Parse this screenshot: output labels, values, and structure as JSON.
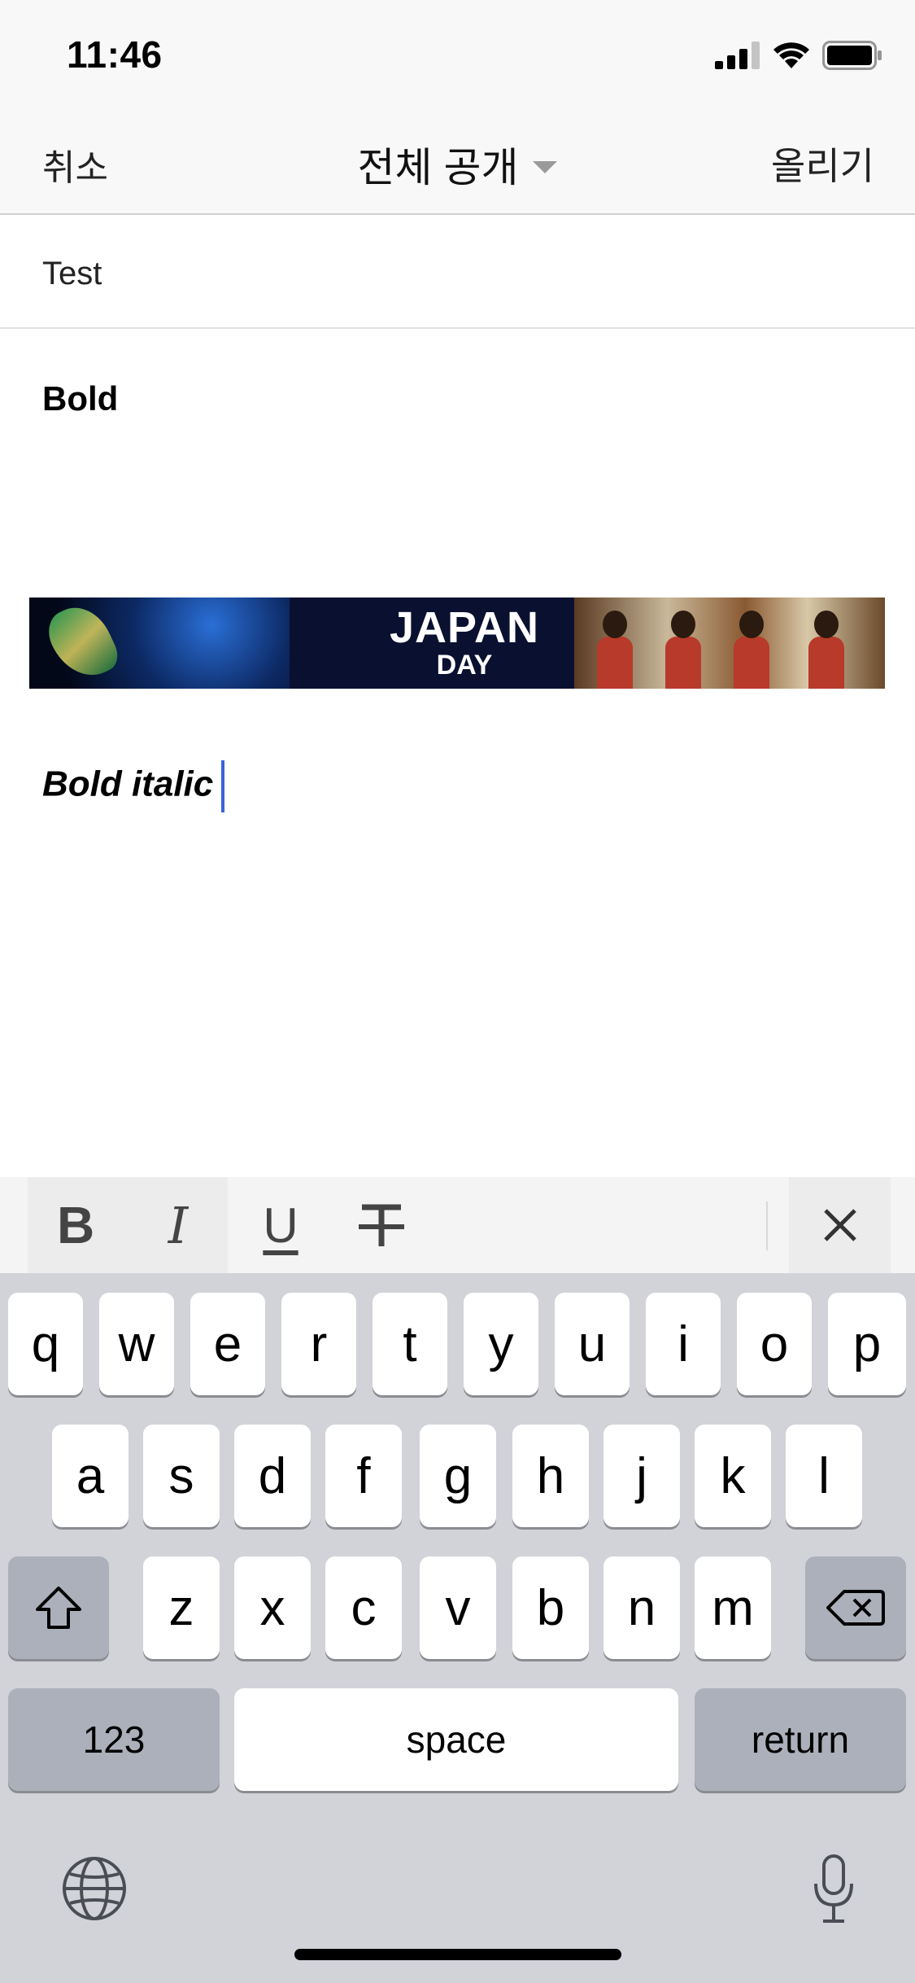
{
  "status": {
    "time": "11:46"
  },
  "nav": {
    "cancel": "취소",
    "title": "전체 공개",
    "upload": "올리기"
  },
  "title_field": {
    "value": "Test"
  },
  "editor": {
    "bold_text": "Bold",
    "banner": {
      "line1": "JAPAN",
      "line2": "DAY"
    },
    "bold_italic_text": "Bold italic"
  },
  "format_toolbar": {
    "bold": "B",
    "italic": "I",
    "underline": "U",
    "strike": "T",
    "close": "×"
  },
  "keyboard": {
    "row1": [
      "q",
      "w",
      "e",
      "r",
      "t",
      "y",
      "u",
      "i",
      "o",
      "p"
    ],
    "row2": [
      "a",
      "s",
      "d",
      "f",
      "g",
      "h",
      "j",
      "k",
      "l"
    ],
    "row3": [
      "z",
      "x",
      "c",
      "v",
      "b",
      "n",
      "m"
    ],
    "numbers": "123",
    "space": "space",
    "return": "return"
  }
}
